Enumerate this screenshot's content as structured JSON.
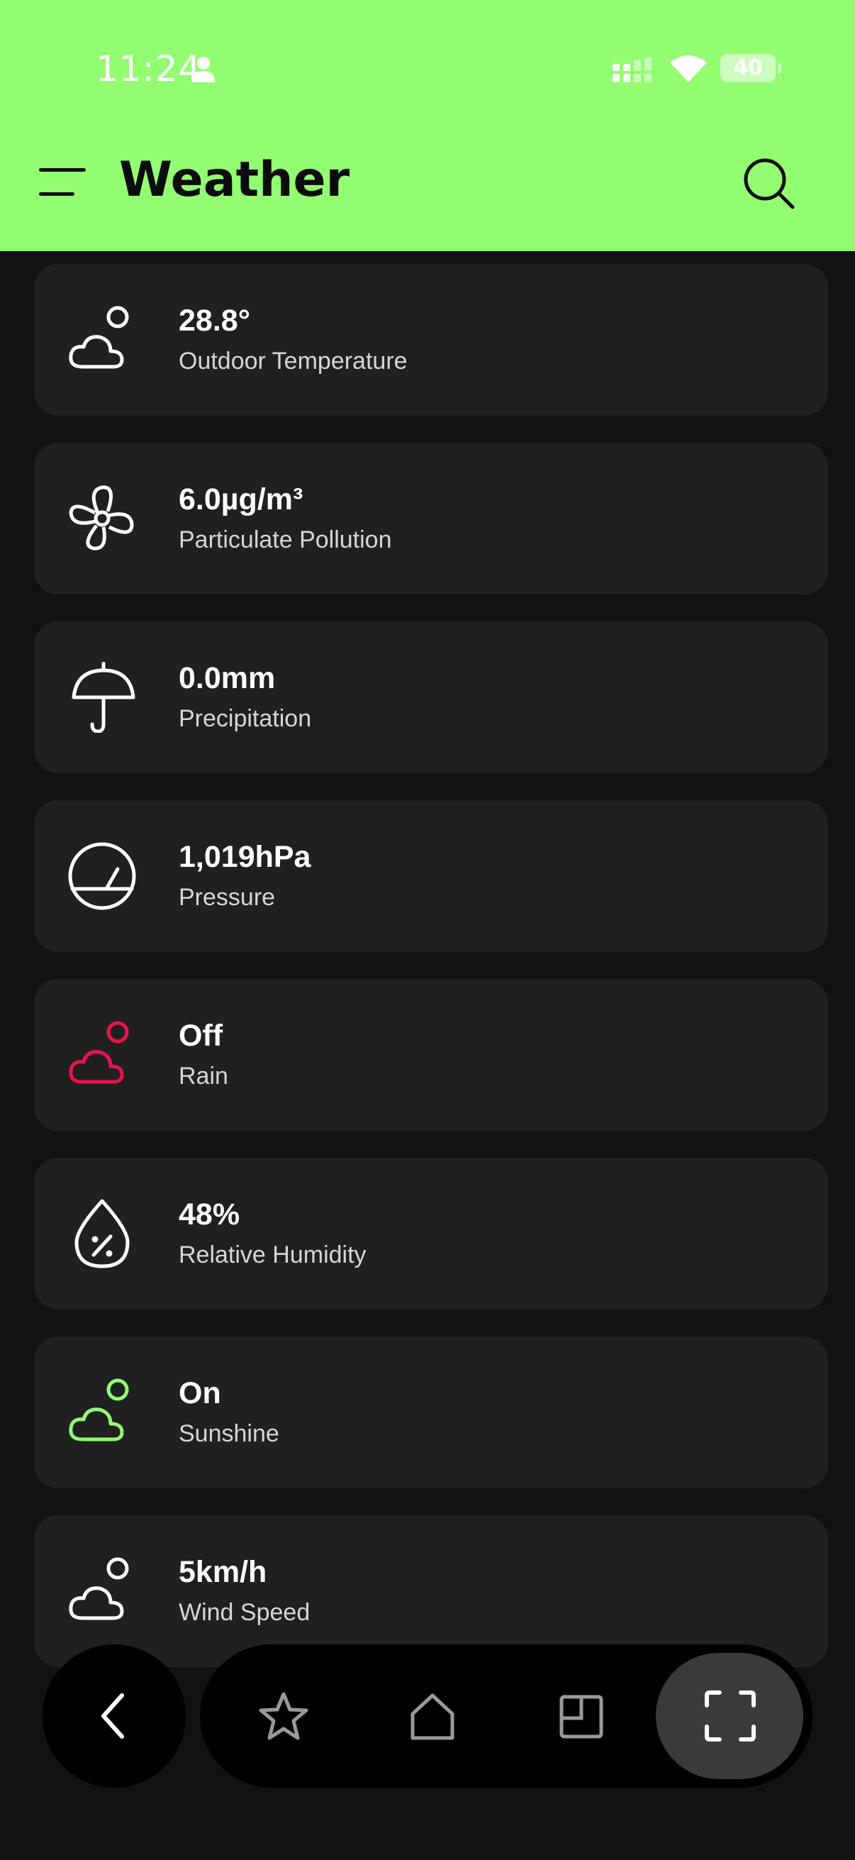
{
  "status_bar": {
    "time": "11:24",
    "battery": "40"
  },
  "app_bar": {
    "title": "Weather"
  },
  "cards": [
    {
      "value": "28.8°",
      "label": "Outdoor Temperature",
      "icon": "cloud-sun-icon"
    },
    {
      "value": "6.0µg/m³",
      "label": "Particulate Pollution",
      "icon": "fan-icon"
    },
    {
      "value": "0.0mm",
      "label": "Precipitation",
      "icon": "umbrella-icon"
    },
    {
      "value": "1,019hPa",
      "label": "Pressure",
      "icon": "gauge-icon"
    },
    {
      "value": "Off",
      "label": "Rain",
      "icon": "cloud-sun-icon",
      "color": "#e8134e"
    },
    {
      "value": "48%",
      "label": "Relative Humidity",
      "icon": "humidity-drop-icon"
    },
    {
      "value": "On",
      "label": "Sunshine",
      "icon": "cloud-sun-icon",
      "color": "#93fd72"
    },
    {
      "value": "5km/h",
      "label": "Wind Speed",
      "icon": "cloud-sun-icon"
    }
  ],
  "colors": {
    "accent": "#93fd72",
    "rain": "#e8134e",
    "card": "#202020",
    "background": "#121212"
  },
  "bottom_nav": [
    "back-icon",
    "star-icon",
    "home-icon",
    "window-icon",
    "scan-icon"
  ]
}
